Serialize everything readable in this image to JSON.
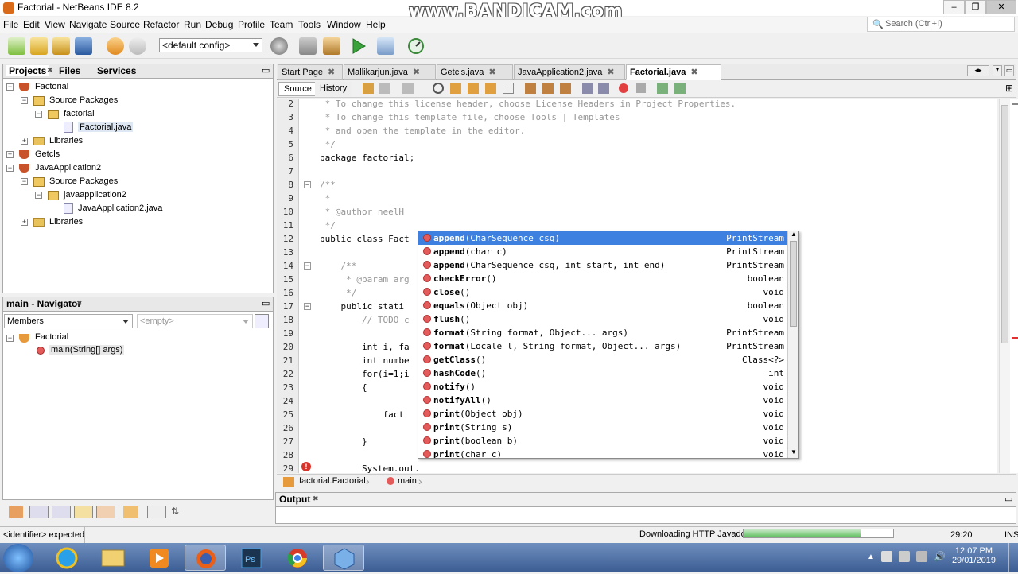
{
  "window": {
    "title": "Factorial - NetBeans IDE 8.2",
    "watermark": "www.BANDICAM.com"
  },
  "menu": [
    "File",
    "Edit",
    "View",
    "Navigate",
    "Source",
    "Refactor",
    "Run",
    "Debug",
    "Profile",
    "Team",
    "Tools",
    "Window",
    "Help"
  ],
  "search": {
    "placeholder": "Search (Ctrl+I)"
  },
  "toolbar": {
    "config": "<default config>"
  },
  "projects_panel": {
    "tabs": [
      "Projects",
      "Files",
      "Services"
    ],
    "tree": [
      {
        "label": "Factorial"
      },
      {
        "label": "Source Packages"
      },
      {
        "label": "factorial"
      },
      {
        "label": "Factorial.java"
      },
      {
        "label": "Libraries"
      },
      {
        "label": "Getcls"
      },
      {
        "label": "JavaApplication2"
      },
      {
        "label": "Source Packages"
      },
      {
        "label": "javaapplication2"
      },
      {
        "label": "JavaApplication2.java"
      },
      {
        "label": "Libraries"
      }
    ]
  },
  "navigator": {
    "title": "main - Navigator",
    "members_label": "Members",
    "filter_placeholder": "<empty>",
    "items": [
      {
        "label": "Factorial"
      },
      {
        "label": "main(String[] args)"
      }
    ]
  },
  "editor": {
    "tabs": [
      "Start Page",
      "Mallikarjun.java",
      "Getcls.java",
      "JavaApplication2.java",
      "Factorial.java"
    ],
    "active_tab": "Factorial.java",
    "source_label": "Source",
    "history_label": "History",
    "lines": [
      {
        "n": "2",
        "t": " * To change this license header, choose License Headers in Project Properties."
      },
      {
        "n": "3",
        "t": " * To change this template file, choose Tools | Templates"
      },
      {
        "n": "4",
        "t": " * and open the template in the editor."
      },
      {
        "n": "5",
        "t": " */"
      },
      {
        "n": "6",
        "t": "package factorial;"
      },
      {
        "n": "7",
        "t": ""
      },
      {
        "n": "8",
        "t": "/**"
      },
      {
        "n": "9",
        "t": " *"
      },
      {
        "n": "10",
        "t": " * @author neelH"
      },
      {
        "n": "11",
        "t": " */"
      },
      {
        "n": "12",
        "t": "public class Fact"
      },
      {
        "n": "13",
        "t": ""
      },
      {
        "n": "14",
        "t": "    /**"
      },
      {
        "n": "15",
        "t": "     * @param arg"
      },
      {
        "n": "16",
        "t": "     */"
      },
      {
        "n": "17",
        "t": "    public stati"
      },
      {
        "n": "18",
        "t": "        // TODO c"
      },
      {
        "n": "19",
        "t": ""
      },
      {
        "n": "20",
        "t": "        int i, fa"
      },
      {
        "n": "21",
        "t": "        int numbe"
      },
      {
        "n": "22",
        "t": "        for(i=1;i"
      },
      {
        "n": "23",
        "t": "        {"
      },
      {
        "n": "24",
        "t": ""
      },
      {
        "n": "25",
        "t": "            fact"
      },
      {
        "n": "26",
        "t": ""
      },
      {
        "n": "27",
        "t": "        }"
      },
      {
        "n": "28",
        "t": ""
      },
      {
        "n": "29",
        "t": "        System.out."
      }
    ]
  },
  "completion": [
    {
      "name": "append",
      "params": "(CharSequence csq)",
      "ret": "PrintStream",
      "selected": true
    },
    {
      "name": "append",
      "params": "(char c)",
      "ret": "PrintStream"
    },
    {
      "name": "append",
      "params": "(CharSequence csq, int start, int end)",
      "ret": "PrintStream"
    },
    {
      "name": "checkError",
      "params": "()",
      "ret": "boolean"
    },
    {
      "name": "close",
      "params": "()",
      "ret": "void"
    },
    {
      "name": "equals",
      "params": "(Object obj)",
      "ret": "boolean"
    },
    {
      "name": "flush",
      "params": "()",
      "ret": "void"
    },
    {
      "name": "format",
      "params": "(String format, Object... args)",
      "ret": "PrintStream"
    },
    {
      "name": "format",
      "params": "(Locale l, String format, Object... args)",
      "ret": "PrintStream"
    },
    {
      "name": "getClass",
      "params": "()",
      "ret": "Class<?>"
    },
    {
      "name": "hashCode",
      "params": "()",
      "ret": "int"
    },
    {
      "name": "notify",
      "params": "()",
      "ret": "void"
    },
    {
      "name": "notifyAll",
      "params": "()",
      "ret": "void"
    },
    {
      "name": "print",
      "params": "(Object obj)",
      "ret": "void"
    },
    {
      "name": "print",
      "params": "(String s)",
      "ret": "void"
    },
    {
      "name": "print",
      "params": "(boolean b)",
      "ret": "void"
    },
    {
      "name": "print",
      "params": "(char c)",
      "ret": "void"
    }
  ],
  "breadcrumb": [
    "factorial.Factorial",
    "main"
  ],
  "output": {
    "title": "Output"
  },
  "status": {
    "message": "<identifier> expected",
    "download": "Downloading HTTP Javadoc",
    "download_progress": 0.78,
    "position": "29:20",
    "mode": "INS"
  },
  "taskbar": {
    "time": "12:07 PM",
    "date": "29/01/2019"
  },
  "colors": {
    "selection": "#3d80df",
    "keyword": "#0000e6",
    "comment": "#969696"
  }
}
